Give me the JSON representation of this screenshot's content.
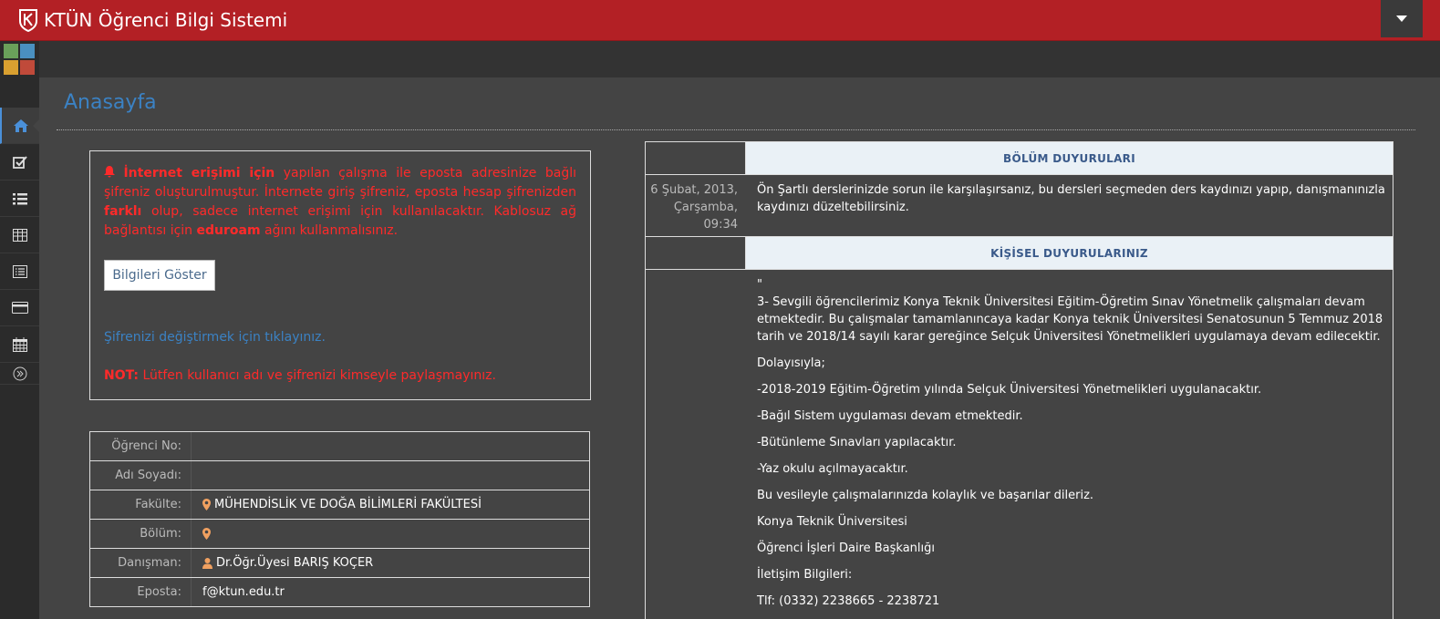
{
  "app": {
    "title": "KTÜN Öğrenci Bilgi Sistemi"
  },
  "page": {
    "title": "Anasayfa"
  },
  "sidebar": {
    "items": [
      {
        "name": "home-icon"
      },
      {
        "name": "check-square-icon"
      },
      {
        "name": "list-icon"
      },
      {
        "name": "table-icon"
      },
      {
        "name": "list-alt-icon"
      },
      {
        "name": "credit-card-icon"
      },
      {
        "name": "calendar-icon"
      }
    ]
  },
  "notice": {
    "message_part1": "İnternet erişimi için",
    "message_part2": " yapılan çalışma ile eposta adresinize bağlı şifreniz oluşturulmuştur. İnternete giriş şifreniz, eposta hesap şifrenizden ",
    "message_part3": "farklı",
    "message_part4": " olup, sadece internet erişimi için kullanılacaktır. Kablosuz ağ bağlantısı için ",
    "message_part5": "eduroam",
    "message_part6": " ağını kullanmalısınız.",
    "show_button": "Bilgileri Göster",
    "password_link": "Şifrenizi değiştirmek için tıklayınız.",
    "not_label": "NOT:",
    "not_text": " Lütfen kullanıcı adı ve şifrenizi kimseyle paylaşmayınız."
  },
  "student": {
    "rows": [
      {
        "label": "Öğrenci No:",
        "value": ""
      },
      {
        "label": "Adı Soyadı:",
        "value": ""
      },
      {
        "label": "Fakülte:",
        "value": "MÜHENDİSLİK VE DOĞA BİLİMLERİ FAKÜLTESİ"
      },
      {
        "label": "Bölüm:",
        "value": ""
      },
      {
        "label": "Danışman:",
        "value": "Dr.Öğr.Üyesi BARIŞ KOÇER"
      },
      {
        "label": "Eposta:",
        "value": "f@ktun.edu.tr"
      }
    ]
  },
  "department_announcements": {
    "header": "BÖLÜM DUYURULARI",
    "items": [
      {
        "date": "6 Şubat, 2013, Çarşamba, 09:34",
        "text": "Ön Şartlı derslerinizde sorun ile karşılaşırsanız, bu dersleri seçmeden ders kaydınızı yapıp, danışmanınızla kaydınızı düzeltebilirsiniz."
      }
    ]
  },
  "personal_announcements": {
    "header": "KİŞİSEL DUYURULARINIZ",
    "lines": [
      "\"",
      "3- Sevgili öğrencilerimiz Konya Teknik Üniversitesi Eğitim-Öğretim Sınav Yönetmelik çalışmaları devam etmektedir. Bu çalışmalar tamamlanıncaya kadar Konya teknik Üniversitesi Senatosunun 5 Temmuz 2018 tarih ve 2018/14 sayılı karar gereğince Selçuk Üniversitesi Yönetmelikleri uygulamaya devam edilecektir.",
      "Dolayısıyla;",
      "-2018-2019 Eğitim-Öğretim yılında Selçuk Üniversitesi Yönetmelikleri uygulanacaktır.",
      "-Bağıl Sistem uygulaması devam etmektedir.",
      "-Bütünleme Sınavları yapılacaktır.",
      "-Yaz okulu açılmayacaktır.",
      "Bu vesileyle çalışmalarınızda kolaylık ve başarılar dileriz.",
      "Konya Teknik Üniversitesi",
      "Öğrenci İşleri Daire Başkanlığı",
      "İletişim Bilgileri:",
      "Tlf: (0332) 2238665 - 2238721"
    ]
  },
  "colors": {
    "brand": "#b32025",
    "accent": "#3b82c4",
    "alert": "#ff2a2a",
    "icon_orange": "#f0a060"
  }
}
